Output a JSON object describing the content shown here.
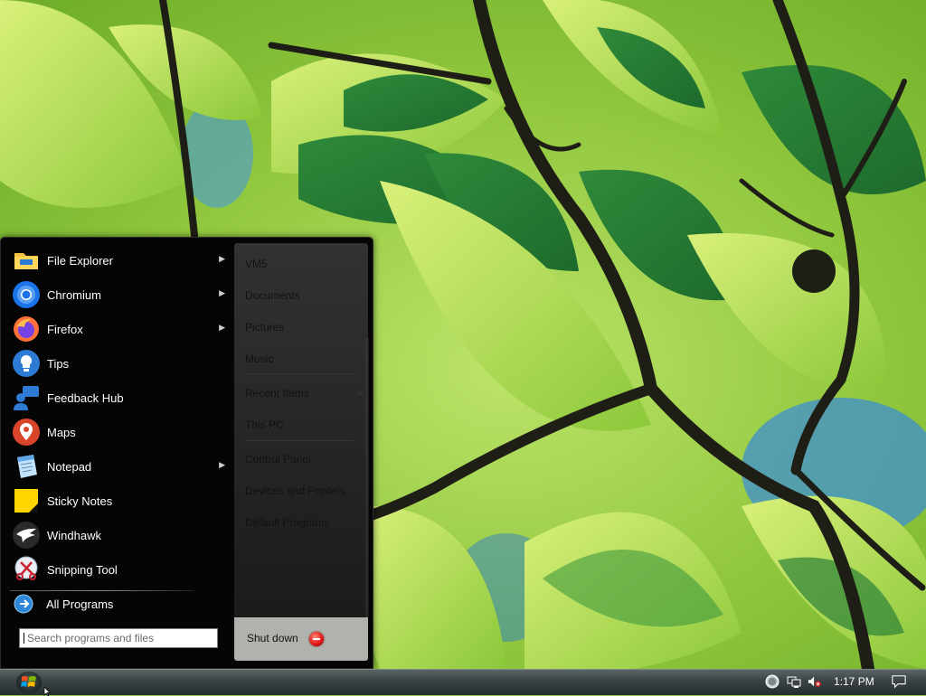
{
  "start_menu": {
    "programs": [
      {
        "label": "File Explorer",
        "icon": "folder-icon",
        "has_submenu": true
      },
      {
        "label": "Chromium",
        "icon": "chromium-icon",
        "has_submenu": true
      },
      {
        "label": "Firefox",
        "icon": "firefox-icon",
        "has_submenu": true
      },
      {
        "label": "Tips",
        "icon": "lightbulb-icon",
        "has_submenu": false
      },
      {
        "label": "Feedback Hub",
        "icon": "feedback-icon",
        "has_submenu": false
      },
      {
        "label": "Maps",
        "icon": "map-pin-icon",
        "has_submenu": false
      },
      {
        "label": "Notepad",
        "icon": "notepad-icon",
        "has_submenu": true
      },
      {
        "label": "Sticky Notes",
        "icon": "sticky-note-icon",
        "has_submenu": false
      },
      {
        "label": "Windhawk",
        "icon": "windhawk-icon",
        "has_submenu": false
      },
      {
        "label": "Snipping Tool",
        "icon": "scissors-icon",
        "has_submenu": false
      }
    ],
    "all_programs": "All Programs",
    "search_placeholder": "Search programs and files",
    "places": [
      {
        "label": "VM5"
      },
      {
        "label": "Documents"
      },
      {
        "label": "Pictures"
      },
      {
        "label": "Music"
      },
      {
        "label": "Recent Items",
        "has_submenu": true
      },
      {
        "label": "This PC"
      },
      {
        "label": "Control Panel"
      },
      {
        "label": "Devices and Printers"
      },
      {
        "label": "Default Programs"
      }
    ],
    "shutdown_label": "Shut down"
  },
  "taskbar": {
    "clock": "1:17 PM",
    "tray_icons": [
      "globe-icon",
      "network-icon",
      "volume-muted-icon",
      "notification-icon"
    ]
  },
  "colors": {
    "menu_bg": "#050505",
    "taskbar_top": "#5b6465",
    "taskbar_bottom": "#262d2e"
  }
}
